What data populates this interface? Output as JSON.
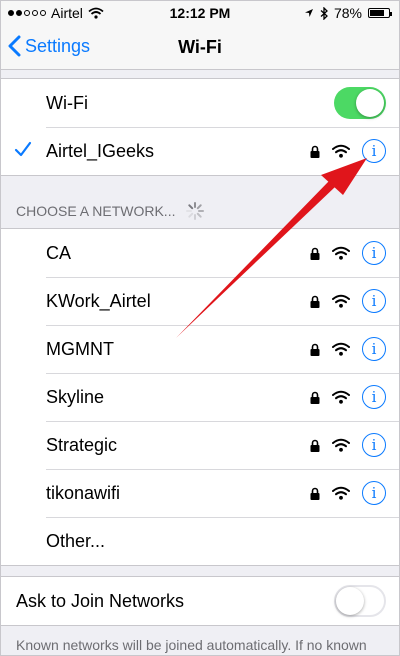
{
  "status_bar": {
    "carrier": "Airtel",
    "time": "12:12 PM",
    "battery": "78%",
    "battery_level": 0.78
  },
  "nav": {
    "back_label": "Settings",
    "title": "Wi-Fi"
  },
  "wifi": {
    "label": "Wi-Fi",
    "enabled": true
  },
  "connected": {
    "name": "Airtel_IGeeks"
  },
  "choose_header": "CHOOSE A NETWORK...",
  "networks": [
    {
      "name": "CA"
    },
    {
      "name": "KWork_Airtel"
    },
    {
      "name": "MGMNT"
    },
    {
      "name": "Skyline"
    },
    {
      "name": "Strategic"
    },
    {
      "name": "tikonawifi"
    }
  ],
  "other_label": "Other...",
  "ask_join": {
    "label": "Ask to Join Networks",
    "enabled": false
  },
  "footer_text": "Known networks will be joined automatically. If no known",
  "colors": {
    "accent": "#0a7aff",
    "toggle_on": "#4cd964",
    "annotation_arrow": "#e0151b"
  }
}
